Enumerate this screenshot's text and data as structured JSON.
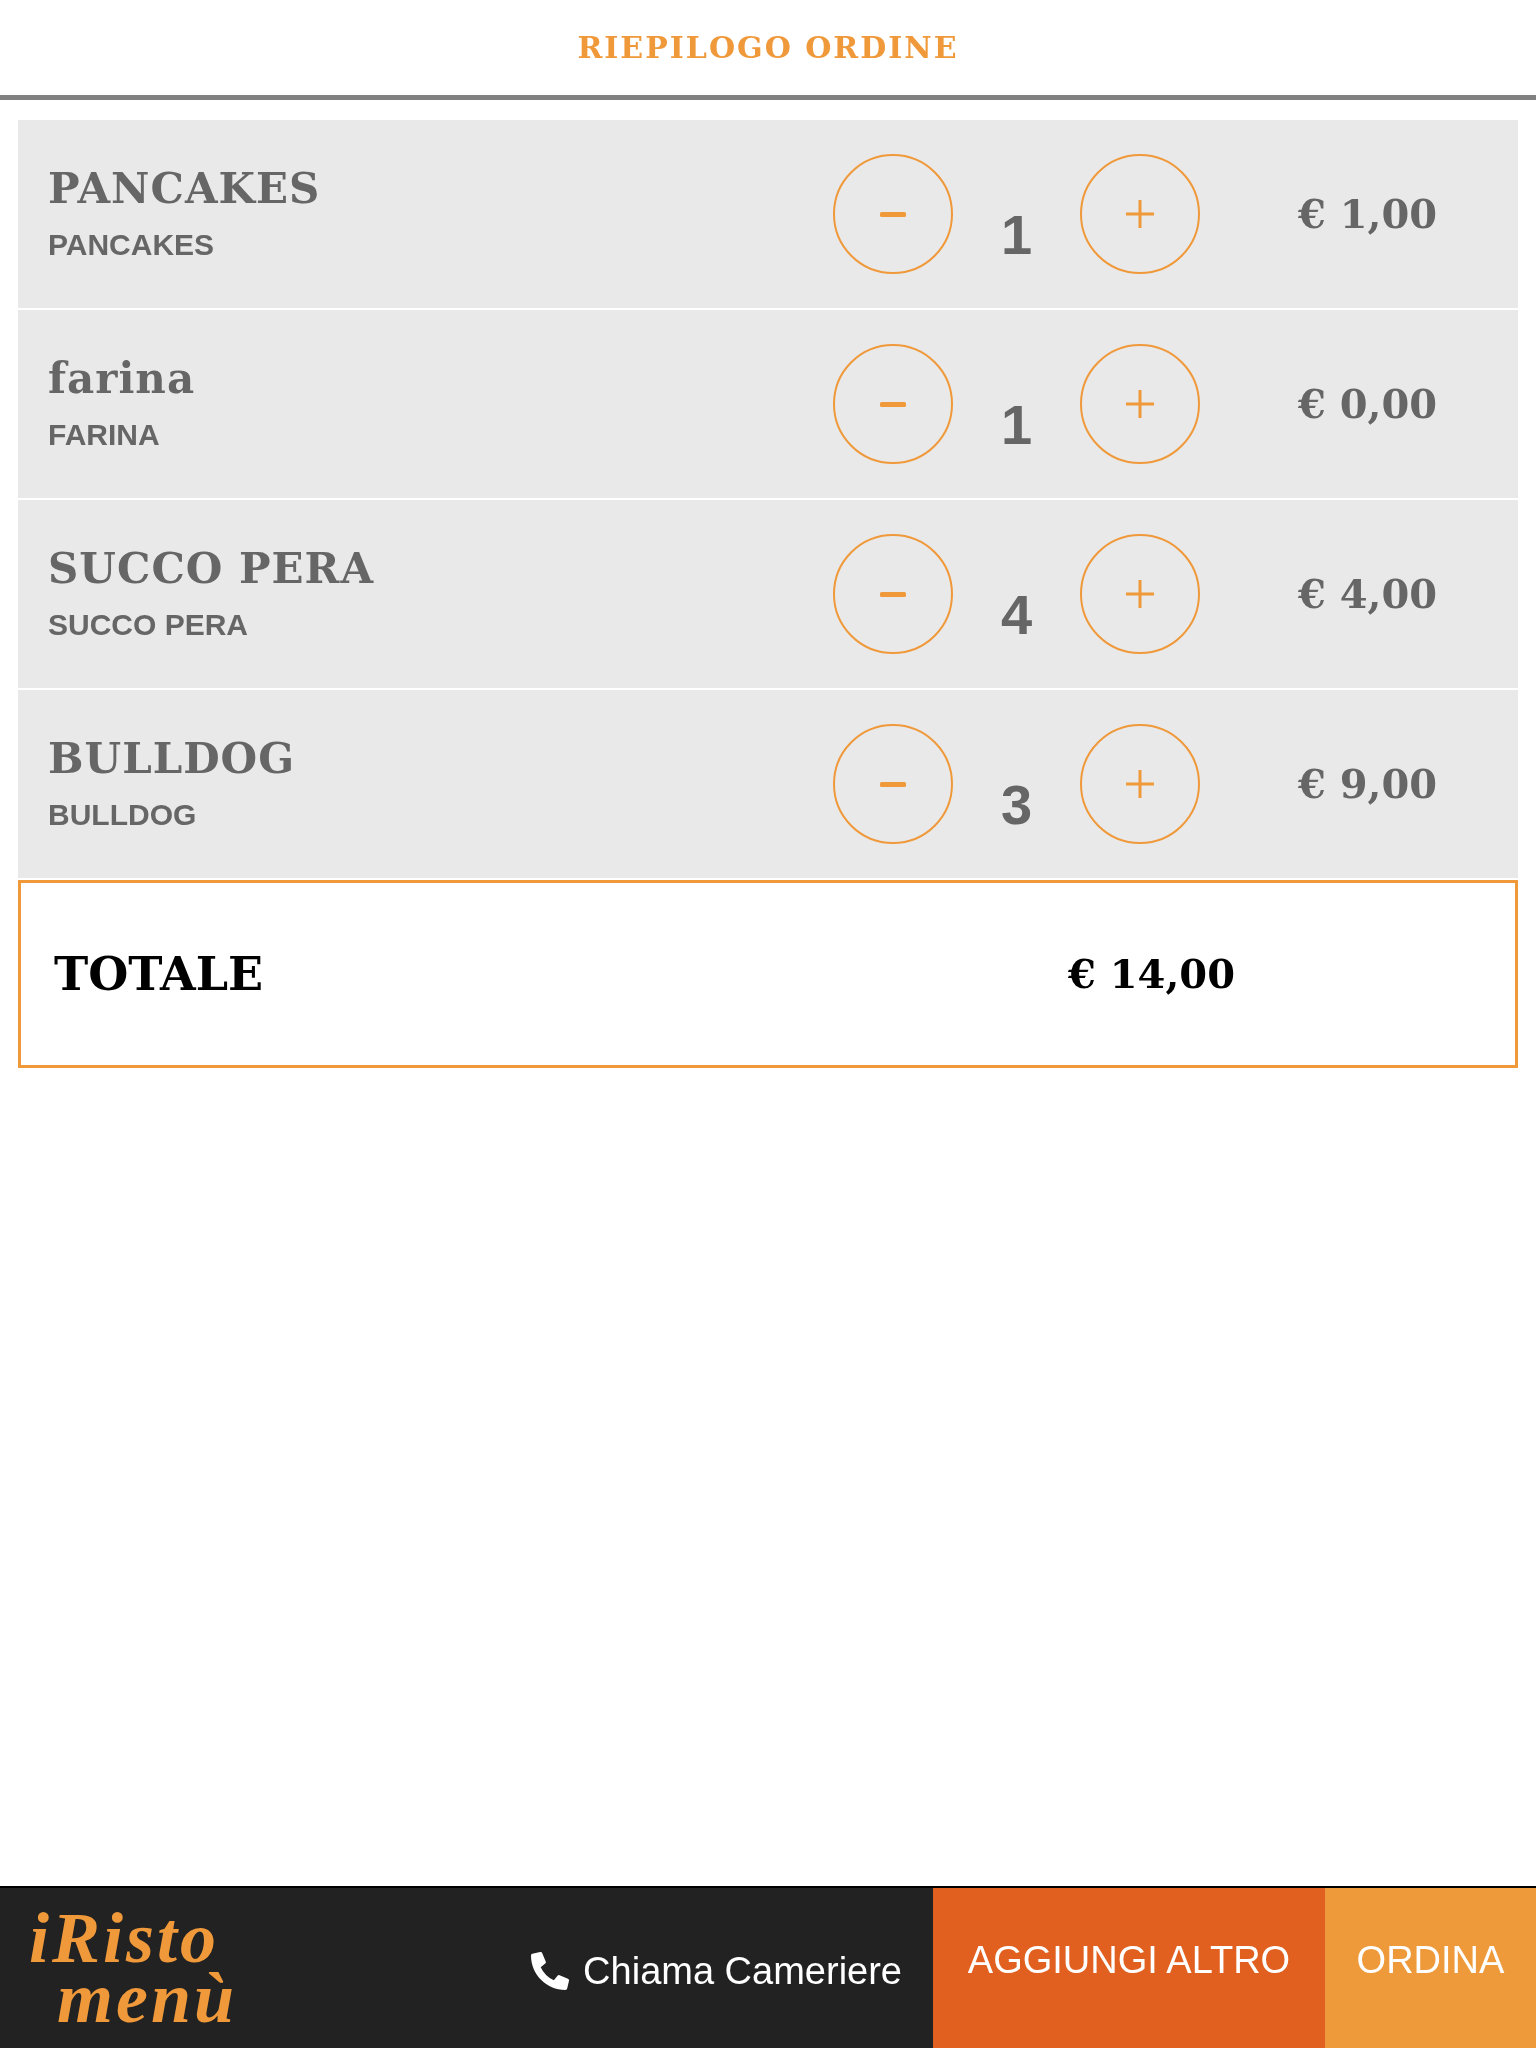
{
  "header": {
    "title": "RIEPILOGO ORDINE"
  },
  "items": [
    {
      "name": "PANCAKES",
      "subtitle": "PANCAKES",
      "quantity": "1",
      "price": "€ 1,00"
    },
    {
      "name": "farina",
      "subtitle": "FARINA",
      "quantity": "1",
      "price": "€ 0,00"
    },
    {
      "name": "SUCCO PERA",
      "subtitle": "SUCCO PERA",
      "quantity": "4",
      "price": "€ 4,00"
    },
    {
      "name": "BULLDOG",
      "subtitle": "BULLDOG",
      "quantity": "3",
      "price": "€ 9,00"
    }
  ],
  "total": {
    "label": "TOTALE",
    "amount": "€ 14,00"
  },
  "bottom_bar": {
    "logo": [
      "iRisto",
      "menù"
    ],
    "call_waiter": "Chiama Cameriere",
    "buttons": [
      {
        "label": "AGGIUNGI ALTRO",
        "kind": "secondary"
      },
      {
        "label": "ORDINA",
        "kind": "primary"
      }
    ]
  }
}
